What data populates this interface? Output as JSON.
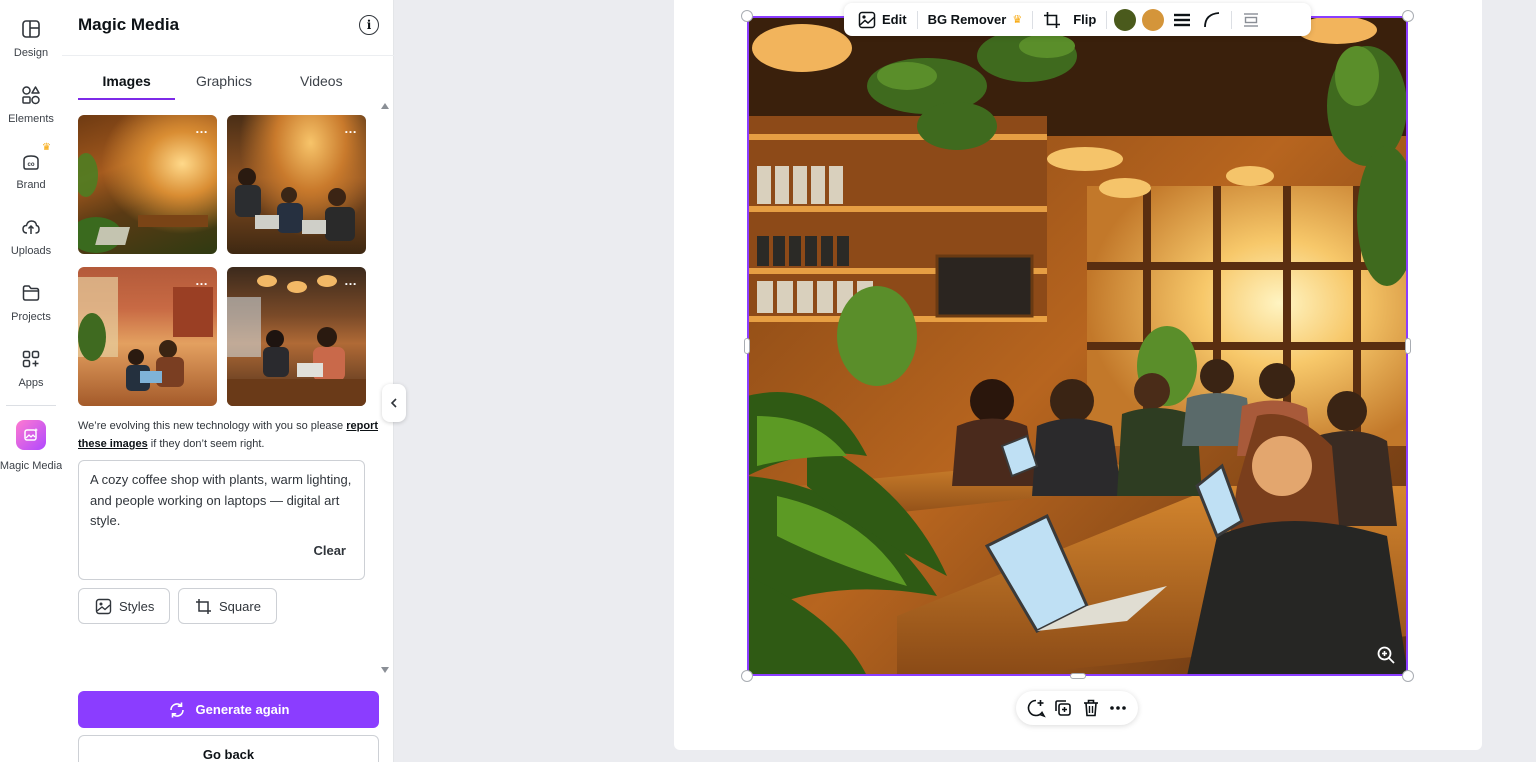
{
  "sidebar": {
    "items": [
      {
        "label": "Design",
        "icon": "layout-icon"
      },
      {
        "label": "Elements",
        "icon": "shapes-icon"
      },
      {
        "label": "Brand",
        "icon": "brand-icon"
      },
      {
        "label": "Uploads",
        "icon": "cloud-upload-icon"
      },
      {
        "label": "Projects",
        "icon": "folder-icon"
      },
      {
        "label": "Apps",
        "icon": "apps-icon"
      },
      {
        "label": "Magic Media",
        "icon": "magic-media-icon"
      }
    ]
  },
  "panel": {
    "title": "Magic Media",
    "tabs": [
      "Images",
      "Graphics",
      "Videos"
    ],
    "active_tab": "Images",
    "thumbnails": [
      {
        "more_label": "…"
      },
      {
        "more_label": "…"
      },
      {
        "more_label": "…"
      },
      {
        "more_label": "…"
      }
    ],
    "notice_text_before": "We’re evolving this new technology with you so please ",
    "notice_link": "report these images",
    "notice_text_after": " if they don’t seem right.",
    "prompt_text": "A cozy coffee shop with plants, warm lighting, and people working on laptops — digital art style.",
    "clear_label": "Clear",
    "styles_label": "Styles",
    "aspect_label": "Square",
    "generate_label": "Generate again",
    "back_label": "Go back"
  },
  "toolbar": {
    "edit_label": "Edit",
    "bg_remover_label": "BG Remover",
    "flip_label": "Flip",
    "colors": [
      "#4a5a1c",
      "#d4953a"
    ]
  },
  "colors": {
    "accent": "#8b3dff",
    "selection": "#8b3dff"
  }
}
